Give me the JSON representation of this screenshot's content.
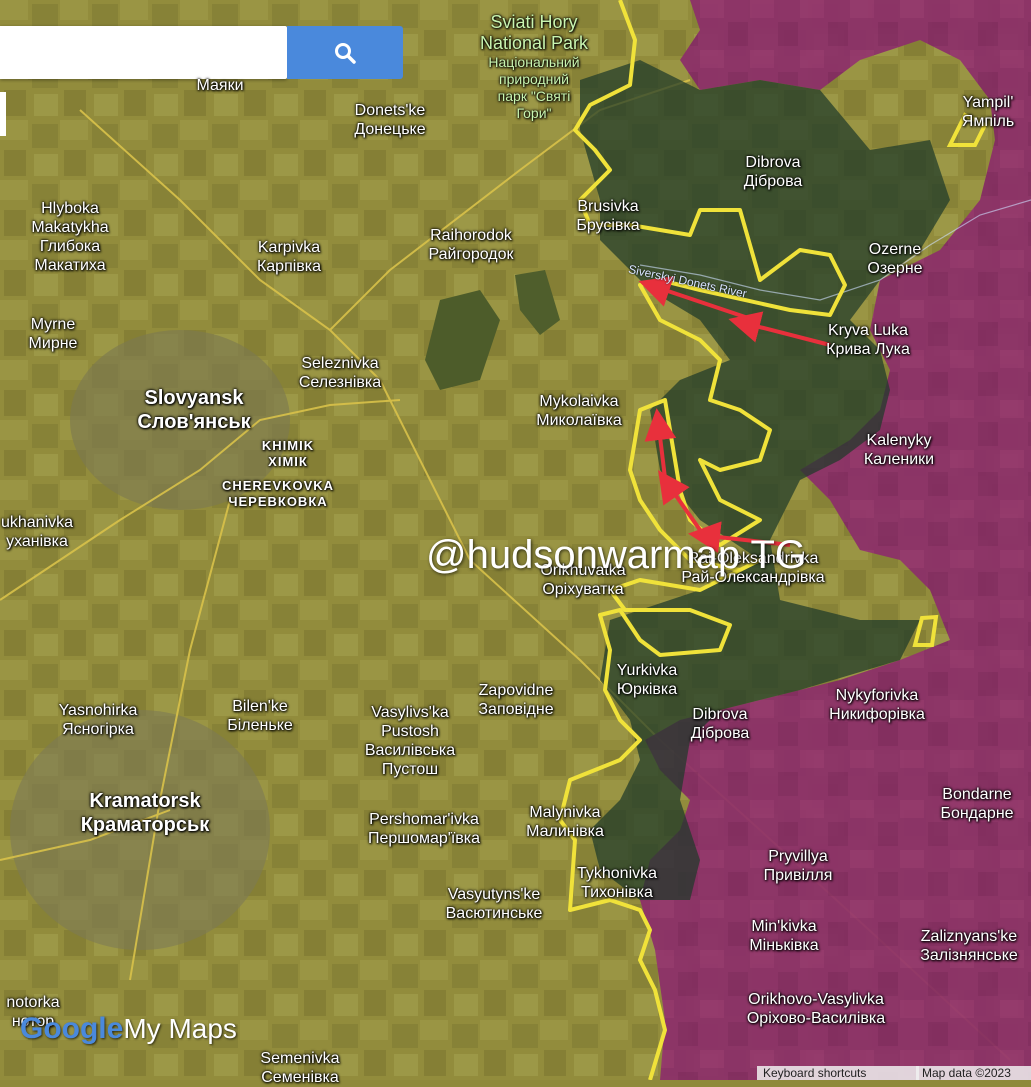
{
  "search": {
    "placeholder": "",
    "value": ""
  },
  "icons": {
    "search": "search-icon"
  },
  "watermark": "@hudsonwarmap TG",
  "branding": {
    "google": "Google",
    "mymaps": "My Maps"
  },
  "footer": {
    "shortcuts": "Keyboard shortcuts",
    "mapdata": "Map data ©2023"
  },
  "colors": {
    "occupied": "#8c2d6a",
    "frontline": "#f0e23a",
    "arrow": "#e8303c",
    "fields": "#8f8a3a"
  },
  "park": {
    "name_en": "Sviati Hory",
    "name_en2": "National Park",
    "name_ua1": "Національний",
    "name_ua2": "природний",
    "name_ua3": "парк \"Святі",
    "name_ua4": "Гори\""
  },
  "river": "Siverskyi Donets River",
  "places": {
    "mayaky": {
      "ua": "Маяки"
    },
    "donetske": {
      "en": "Donets'ke",
      "ua": "Донецьке"
    },
    "yampil": {
      "en": "Yampil'",
      "ua": "Ямпіль"
    },
    "hlyboka": {
      "en1": "Hlyboka",
      "en2": "Makatykha",
      "ua1": "Глибока",
      "ua2": "Макатиха"
    },
    "dibrova_n": {
      "en": "Dibrova",
      "ua": "Діброва"
    },
    "brusivka": {
      "en": "Brusivka",
      "ua": "Брусівка"
    },
    "raihorodok": {
      "en": "Raihorodok",
      "ua": "Райгородок"
    },
    "karpivka": {
      "en": "Karpivka",
      "ua": "Карпівка"
    },
    "ozerne": {
      "en": "Ozerne",
      "ua": "Озерне"
    },
    "myrne": {
      "en": "Myrne",
      "ua": "Мирне"
    },
    "kryvaluka": {
      "en": "Kryva Luka",
      "ua": "Крива Лука"
    },
    "seleznivka": {
      "en": "Seleznivka",
      "ua": "Селезнівка"
    },
    "slovyansk": {
      "en": "Slovyansk",
      "ua": "Слов'янськ"
    },
    "mykolaivka": {
      "en": "Mykolaivka",
      "ua": "Миколаївка"
    },
    "khimik": {
      "en": "KHIMIK",
      "ua": "ХІМІК"
    },
    "kalenyky": {
      "en": "Kalenyky",
      "ua": "Каленики"
    },
    "cherevkovka": {
      "en": "CHEREVKOVKA",
      "ua": "ЧЕРЕВКОВКА"
    },
    "sukhanivka": {
      "en": "ukhanivka",
      "ua": "уханівка"
    },
    "orikhuvatka": {
      "en": "Orikhuvatka",
      "ua": "Оріхуватка"
    },
    "raioleks": {
      "en": "Rai-Oleksandrivka",
      "ua": "Рай-Олександрівка"
    },
    "yurkivka": {
      "en": "Yurkivka",
      "ua": "Юрківка"
    },
    "zapovidne": {
      "en": "Zapovidne",
      "ua": "Заповідне"
    },
    "nykyforivka": {
      "en": "Nykyforivka",
      "ua": "Никифорівка"
    },
    "yasnohirka": {
      "en": "Yasnohirka",
      "ua": "Ясногірка"
    },
    "bilenke": {
      "en": "Bilen'ke",
      "ua": "Біленьке"
    },
    "vasylivska": {
      "en1": "Vasylivs'ka",
      "en2": "Pustosh",
      "ua1": "Василівська",
      "ua2": "Пустош"
    },
    "dibrova_s": {
      "en": "Dibrova",
      "ua": "Діброва"
    },
    "kramatorsk": {
      "en": "Kramatorsk",
      "ua": "Краматорськ"
    },
    "bondarne": {
      "en": "Bondarne",
      "ua": "Бондарне"
    },
    "malynivka": {
      "en": "Malynivka",
      "ua": "Малинівка"
    },
    "pershomarivka": {
      "en": "Pershomar'ivka",
      "ua": "Першомар'ївка"
    },
    "pryvillya": {
      "en": "Pryvillya",
      "ua": "Привілля"
    },
    "tykhonivka": {
      "en": "Tykhonivka",
      "ua": "Тихонівка"
    },
    "vasyutynske": {
      "en": "Vasyutyns'ke",
      "ua": "Васютинське"
    },
    "minkivka": {
      "en": "Min'kivka",
      "ua": "Міньківка"
    },
    "zaliznyanske": {
      "en": "Zaliznyans'ke",
      "ua": "Залізнянське"
    },
    "orikhovo": {
      "en": "Orikhovo-Vasylivka",
      "ua": "Оріхово-Василівка"
    },
    "notorka": {
      "en": "notorka",
      "ua": "нотор"
    },
    "semenivka": {
      "en": "Semenivka",
      "ua": "Семенівка"
    }
  }
}
